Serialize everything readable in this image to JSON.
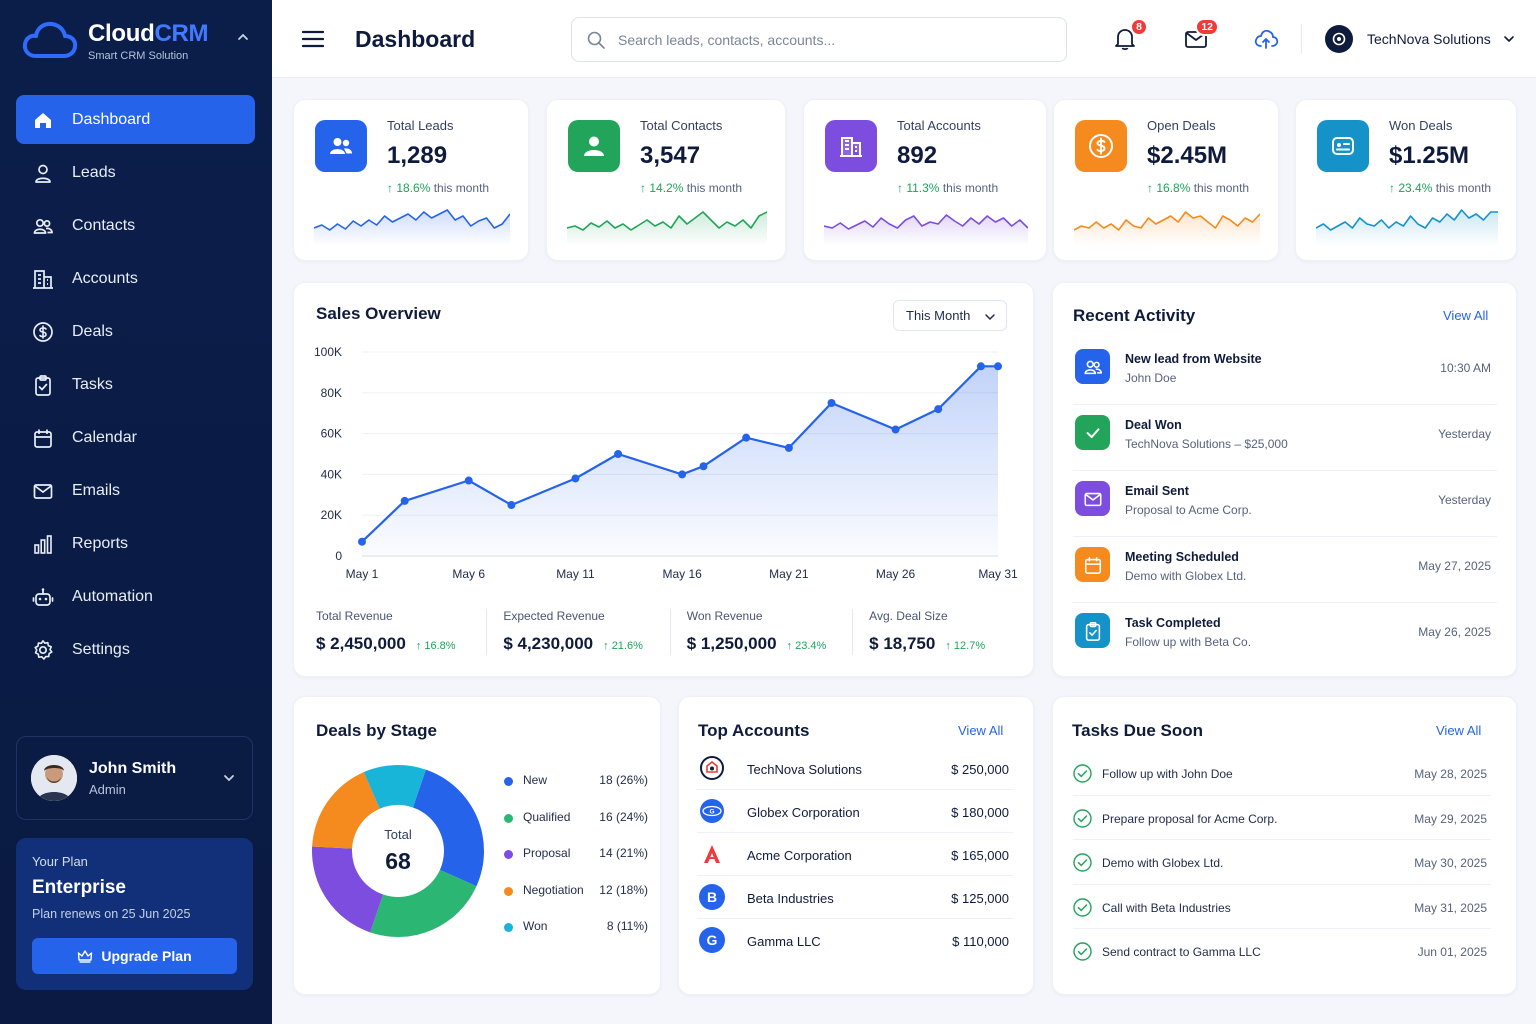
{
  "brand": {
    "name_a": "Cloud",
    "name_b": "CRM",
    "subtitle": "Smart CRM Solution"
  },
  "nav": [
    {
      "label": "Dashboard",
      "icon": "home-icon",
      "active": true
    },
    {
      "label": "Leads",
      "icon": "user-icon"
    },
    {
      "label": "Contacts",
      "icon": "users-icon"
    },
    {
      "label": "Accounts",
      "icon": "building-icon"
    },
    {
      "label": "Deals",
      "icon": "dollar-icon"
    },
    {
      "label": "Tasks",
      "icon": "clipboard-icon"
    },
    {
      "label": "Calendar",
      "icon": "calendar-icon"
    },
    {
      "label": "Emails",
      "icon": "mail-icon"
    },
    {
      "label": "Reports",
      "icon": "bar-chart-icon"
    },
    {
      "label": "Automation",
      "icon": "robot-icon"
    },
    {
      "label": "Settings",
      "icon": "gear-icon"
    }
  ],
  "user": {
    "name": "John Smith",
    "role": "Admin"
  },
  "plan": {
    "label": "Your Plan",
    "name": "Enterprise",
    "renew": "Plan renews on 25 Jun 2025",
    "button": "Upgrade Plan"
  },
  "header": {
    "title": "Dashboard",
    "search_placeholder": "Search leads, contacts, accounts...",
    "notifications": "8",
    "messages": "12",
    "org": "TechNova Solutions"
  },
  "stats": [
    {
      "label": "Total Leads",
      "value": "1,289",
      "change": "18.6%",
      "suffix": "this month",
      "color": "#2563eb"
    },
    {
      "label": "Total Contacts",
      "value": "3,547",
      "change": "14.2%",
      "suffix": "this month",
      "color": "#22a55b"
    },
    {
      "label": "Total Accounts",
      "value": "892",
      "change": "11.3%",
      "suffix": "this month",
      "color": "#7c4ddf"
    },
    {
      "label": "Open Deals",
      "value": "$2.45M",
      "change": "16.8%",
      "suffix": "this month",
      "color": "#f58a1f"
    },
    {
      "label": "Won Deals",
      "value": "$1.25M",
      "change": "23.4%",
      "suffix": "this month",
      "color": "#1593c8"
    }
  ],
  "sales": {
    "title": "Sales Overview",
    "period": "This Month",
    "kpis": [
      {
        "label": "Total Revenue",
        "value": "$ 2,450,000",
        "change": "16.8%"
      },
      {
        "label": "Expected Revenue",
        "value": "$ 4,230,000",
        "change": "21.6%"
      },
      {
        "label": "Won Revenue",
        "value": "$ 1,250,000",
        "change": "23.4%"
      },
      {
        "label": "Avg. Deal Size",
        "value": "$ 18,750",
        "change": "12.7%"
      }
    ]
  },
  "chart_data": {
    "type": "area",
    "x": [
      "May 1",
      "May 3",
      "May 6",
      "May 8",
      "May 11",
      "May 13",
      "May 16",
      "May 17",
      "May 19",
      "May 21",
      "May 23",
      "May 26",
      "May 28",
      "May 30",
      "May 31"
    ],
    "values": [
      7000,
      27000,
      37000,
      25000,
      38000,
      50000,
      40000,
      44000,
      58000,
      53000,
      75000,
      62000,
      72000,
      93000,
      93000
    ],
    "x_ticks": [
      "May 1",
      "May 6",
      "May 11",
      "May 16",
      "May 21",
      "May 26",
      "May 31"
    ],
    "y_ticks": [
      "0",
      "20K",
      "40K",
      "60K",
      "80K",
      "100K"
    ],
    "ylim": [
      0,
      100000
    ],
    "color": "#2563eb"
  },
  "activity": {
    "title": "Recent Activity",
    "view_all": "View All",
    "items": [
      {
        "title": "New lead from Website",
        "sub": "John Doe",
        "time": "10:30 AM",
        "color": "#2563eb",
        "icon": "users-icon"
      },
      {
        "title": "Deal Won",
        "sub": "TechNova Solutions – $25,000",
        "time": "Yesterday",
        "color": "#22a55b",
        "icon": "check-icon"
      },
      {
        "title": "Email Sent",
        "sub": "Proposal to Acme Corp.",
        "time": "Yesterday",
        "color": "#7c4ddf",
        "icon": "mail-icon"
      },
      {
        "title": "Meeting Scheduled",
        "sub": "Demo with Globex Ltd.",
        "time": "May 27, 2025",
        "color": "#f58a1f",
        "icon": "calendar-icon"
      },
      {
        "title": "Task Completed",
        "sub": "Follow up with Beta Co.",
        "time": "May 26, 2025",
        "color": "#1593c8",
        "icon": "clipboard-icon"
      }
    ]
  },
  "deals": {
    "title": "Deals by Stage",
    "total_label": "Total",
    "total": "68",
    "stages": [
      {
        "name": "New",
        "value": "18 (26%)",
        "count": 18,
        "color": "#2563eb"
      },
      {
        "name": "Qualified",
        "value": "16 (24%)",
        "count": 16,
        "color": "#2bb673"
      },
      {
        "name": "Proposal",
        "value": "14 (21%)",
        "count": 14,
        "color": "#7c4ddf"
      },
      {
        "name": "Negotiation",
        "value": "12 (18%)",
        "count": 12,
        "color": "#f58a1f"
      },
      {
        "name": "Won",
        "value": "8 (11%)",
        "count": 8,
        "color": "#19b5d8"
      }
    ]
  },
  "accounts": {
    "title": "Top Accounts",
    "view_all": "View All",
    "items": [
      {
        "name": "TechNova Solutions",
        "value": "$ 250,000",
        "logo": "",
        "color": "#ffffff"
      },
      {
        "name": "Globex Corporation",
        "value": "$ 180,000",
        "logo": "",
        "color": "#2563eb"
      },
      {
        "name": "Acme Corporation",
        "value": "$ 165,000",
        "logo": "A",
        "color": "#ffffff"
      },
      {
        "name": "Beta Industries",
        "value": "$ 125,000",
        "logo": "B",
        "color": "#2563eb"
      },
      {
        "name": "Gamma LLC",
        "value": "$ 110,000",
        "logo": "G",
        "color": "#2563eb"
      }
    ]
  },
  "tasks": {
    "title": "Tasks Due Soon",
    "view_all": "View All",
    "items": [
      {
        "name": "Follow up with John Doe",
        "date": "May 28, 2025"
      },
      {
        "name": "Prepare proposal for Acme Corp.",
        "date": "May 29, 2025"
      },
      {
        "name": "Demo with Globex Ltd.",
        "date": "May 30, 2025"
      },
      {
        "name": "Call with Beta Industries",
        "date": "May 31, 2025"
      },
      {
        "name": "Send contract to Gamma LLC",
        "date": "Jun 01, 2025"
      }
    ]
  }
}
